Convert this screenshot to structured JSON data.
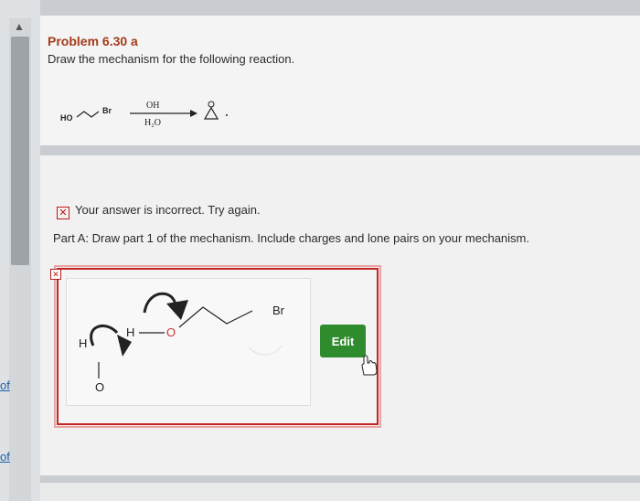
{
  "problem": {
    "title": "Problem 6.30 a",
    "description": "Draw the mechanism for the following reaction."
  },
  "reaction": {
    "reactant_label_ho": "HO",
    "reactant_label_br": "Br",
    "reagent_top": "OH",
    "reagent_bottom": "H₂O"
  },
  "feedback": {
    "message": "Your answer is incorrect.  Try again."
  },
  "part_a": {
    "instruction": "Part A: Draw part 1 of the mechanism. Include charges and lone pairs on your mechanism."
  },
  "mechanism": {
    "h_label": "H",
    "o_label": "O",
    "o2_label": "O",
    "br_label": "Br",
    "h2_label": "H"
  },
  "actions": {
    "edit_label": "Edit"
  },
  "sidebar": {
    "link1": "of",
    "link2": "of"
  }
}
